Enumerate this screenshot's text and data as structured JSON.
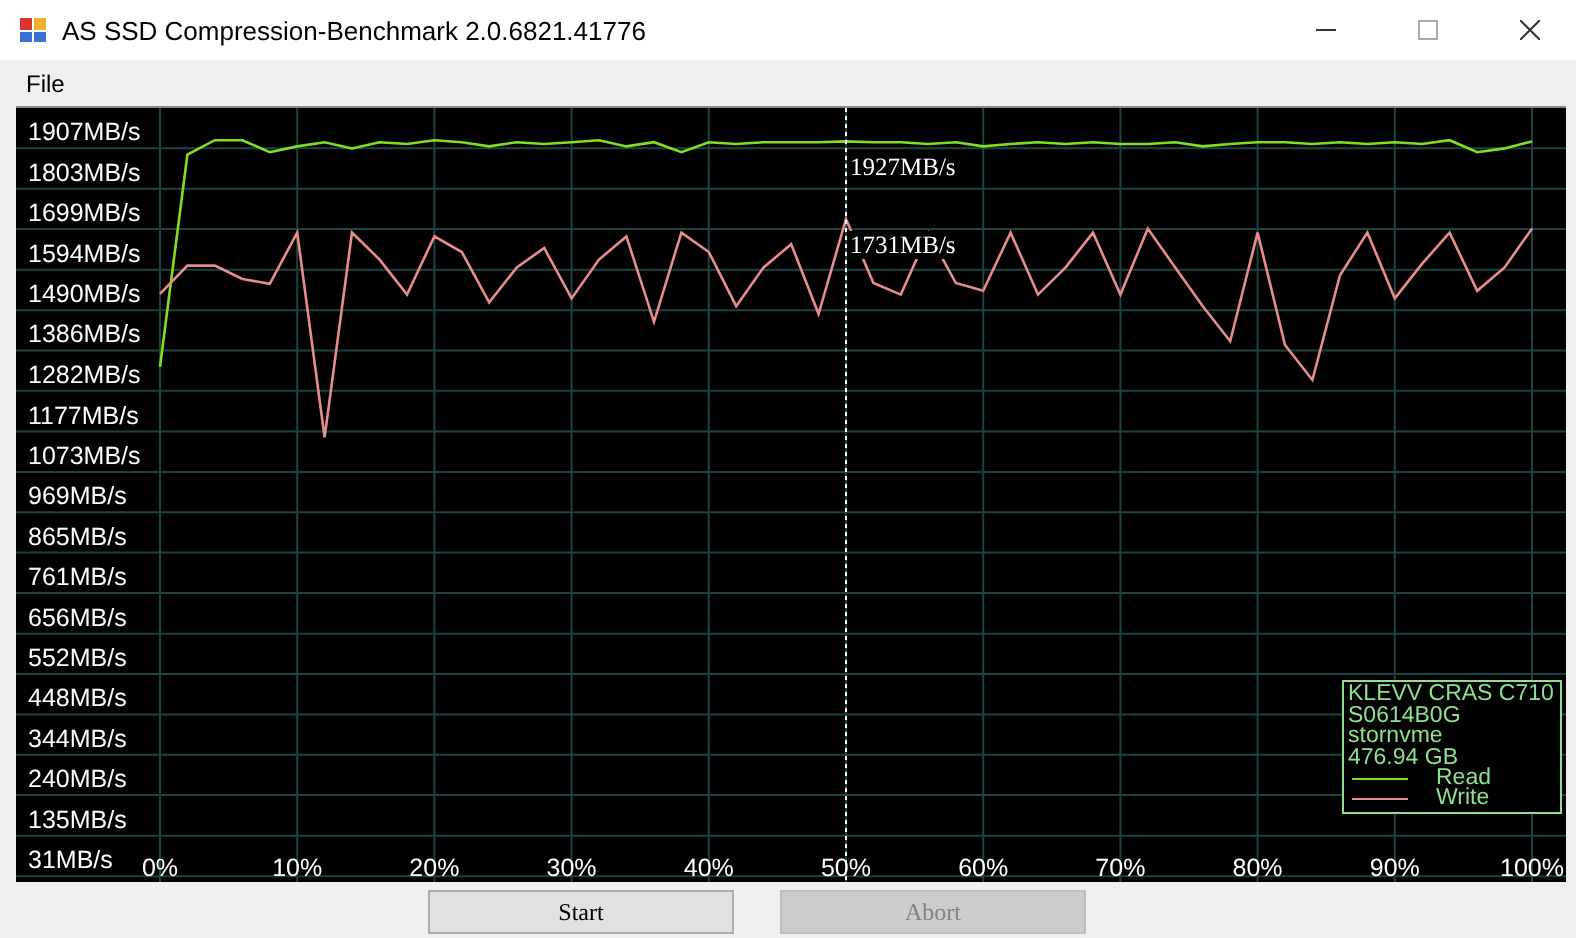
{
  "window": {
    "title": "AS SSD Compression-Benchmark 2.0.6821.41776"
  },
  "menu": [
    "File"
  ],
  "chart_panel": {
    "chart_data": {
      "type": "line",
      "x": [
        0,
        2,
        4,
        6,
        8,
        10,
        12,
        14,
        16,
        18,
        20,
        22,
        24,
        26,
        28,
        30,
        32,
        34,
        36,
        38,
        40,
        42,
        44,
        46,
        48,
        50,
        52,
        54,
        56,
        58,
        60,
        62,
        64,
        66,
        68,
        70,
        72,
        74,
        76,
        78,
        80,
        82,
        84,
        86,
        88,
        90,
        92,
        94,
        96,
        98,
        100
      ],
      "series": [
        {
          "name": "Read",
          "color": "#80e020",
          "values": [
            1344,
            1891,
            1928,
            1928,
            1897,
            1912,
            1923,
            1907,
            1923,
            1918,
            1928,
            1923,
            1912,
            1923,
            1918,
            1923,
            1928,
            1912,
            1923,
            1897,
            1923,
            1918,
            1923,
            1923,
            1923,
            1925,
            1923,
            1923,
            1918,
            1923,
            1912,
            1918,
            1923,
            1918,
            1923,
            1918,
            1918,
            1923,
            1912,
            1918,
            1923,
            1923,
            1918,
            1923,
            1918,
            1923,
            1918,
            1928,
            1897,
            1907,
            1925
          ]
        },
        {
          "name": "Write",
          "color": "#e88c8c",
          "values": [
            1532,
            1605,
            1605,
            1570,
            1558,
            1690,
            1162,
            1690,
            1620,
            1530,
            1680,
            1640,
            1510,
            1600,
            1650,
            1520,
            1620,
            1680,
            1460,
            1690,
            1640,
            1500,
            1600,
            1660,
            1480,
            1725,
            1560,
            1530,
            1690,
            1560,
            1540,
            1690,
            1530,
            1600,
            1690,
            1530,
            1700,
            1600,
            1500,
            1410,
            1690,
            1400,
            1310,
            1580,
            1690,
            1520,
            1610,
            1690,
            1540,
            1600,
            1700
          ]
        }
      ],
      "xlim": [
        0,
        100
      ],
      "ylim": [
        16,
        2011
      ],
      "xticks": [
        {
          "value": 0,
          "label": "0%"
        },
        {
          "value": 10,
          "label": "10%"
        },
        {
          "value": 20,
          "label": "20%"
        },
        {
          "value": 30,
          "label": "30%"
        },
        {
          "value": 40,
          "label": "40%"
        },
        {
          "value": 50,
          "label": "50%"
        },
        {
          "value": 60,
          "label": "60%"
        },
        {
          "value": 70,
          "label": "70%"
        },
        {
          "value": 80,
          "label": "80%"
        },
        {
          "value": 90,
          "label": "90%"
        },
        {
          "value": 100,
          "label": "100%"
        }
      ],
      "yticks": [
        {
          "value": 1907,
          "label": "1907MB/s"
        },
        {
          "value": 1803,
          "label": "1803MB/s"
        },
        {
          "value": 1699,
          "label": "1699MB/s"
        },
        {
          "value": 1594,
          "label": "1594MB/s"
        },
        {
          "value": 1490,
          "label": "1490MB/s"
        },
        {
          "value": 1386,
          "label": "1386MB/s"
        },
        {
          "value": 1282,
          "label": "1282MB/s"
        },
        {
          "value": 1177,
          "label": "1177MB/s"
        },
        {
          "value": 1073,
          "label": "1073MB/s"
        },
        {
          "value": 969,
          "label": "969MB/s"
        },
        {
          "value": 865,
          "label": "865MB/s"
        },
        {
          "value": 761,
          "label": "761MB/s"
        },
        {
          "value": 656,
          "label": "656MB/s"
        },
        {
          "value": 552,
          "label": "552MB/s"
        },
        {
          "value": 448,
          "label": "448MB/s"
        },
        {
          "value": 344,
          "label": "344MB/s"
        },
        {
          "value": 240,
          "label": "240MB/s"
        },
        {
          "value": 135,
          "label": "135MB/s"
        },
        {
          "value": 31,
          "label": "31MB/s"
        }
      ],
      "annotations": [
        "1927MB/s",
        "1731MB/s"
      ],
      "grid": true,
      "legend": true,
      "ref_lines": [
        {
          "axis": "x",
          "value": 50,
          "color": "#ffffff"
        }
      ]
    },
    "info_lines": [
      "KLEVV CRAS C710",
      "S0614B0G",
      "stornvme",
      "476.94 GB"
    ]
  },
  "buttons": [
    {
      "label": "Start",
      "disabled": false
    },
    {
      "label": "Abort",
      "disabled": true
    }
  ]
}
